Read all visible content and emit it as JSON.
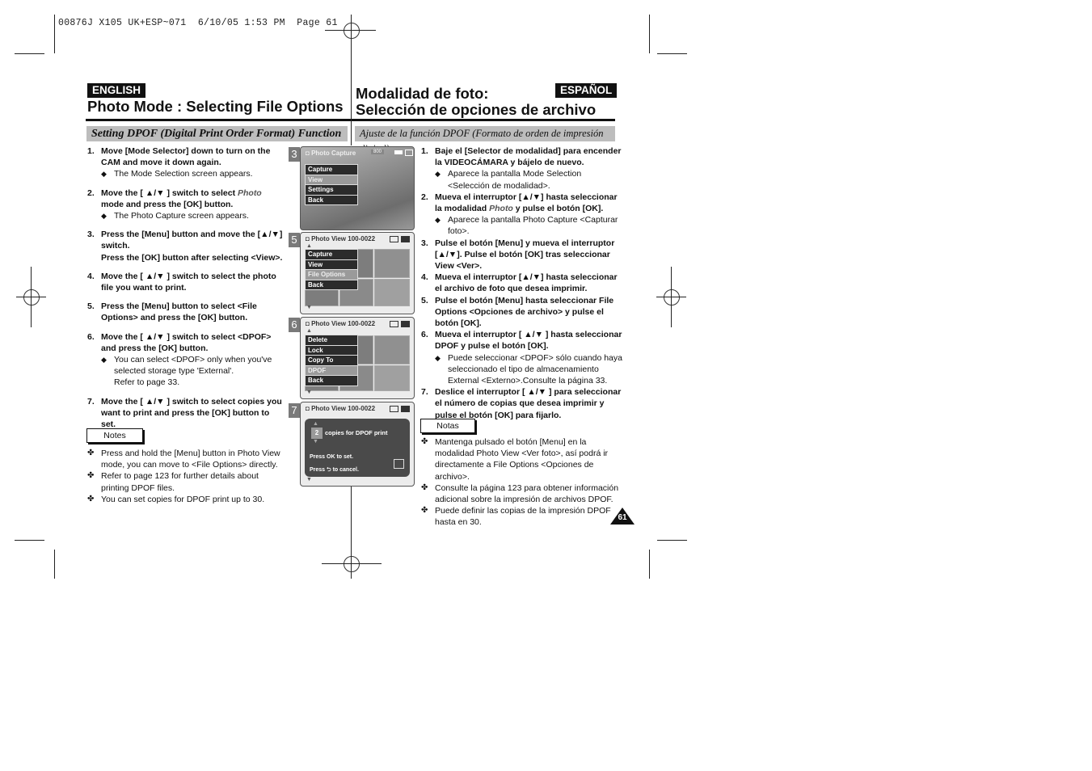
{
  "slug": "00876J X105 UK+ESP~071  6/10/05 1:53 PM  Page 61",
  "english": {
    "badge": "ENGLISH",
    "title": "Photo Mode : Selecting File Options",
    "subhead": "Setting DPOF (Digital Print Order Format) Function",
    "steps": [
      {
        "num": "1.",
        "text": "Move [Mode Selector] down to turn on the CAM and move it down again.",
        "subs": [
          "The Mode Selection screen appears."
        ]
      },
      {
        "num": "2.",
        "pre": "Move the [ ▲/▼ ] switch to select ",
        "italic": "Photo",
        "post": " mode and press the [OK] button.",
        "subs": [
          "The Photo Capture screen appears."
        ]
      },
      {
        "num": "3.",
        "text": "Press the [Menu] button and move the [▲/▼] switch.",
        "text2": "Press the [OK] button after selecting <View>.",
        "subs": []
      },
      {
        "num": "4.",
        "text": "Move the [ ▲/▼ ] switch to select the photo file you want to print.",
        "subs": []
      },
      {
        "num": "5.",
        "text": "Press the [Menu] button to select <File Options> and press the [OK] button.",
        "subs": []
      },
      {
        "num": "6.",
        "text": "Move the [ ▲/▼ ] switch to select <DPOF> and press the [OK] button.",
        "subs": [
          "You can select <DPOF> only when you've selected storage type 'External'.",
          "Refer to page 33."
        ]
      },
      {
        "num": "7.",
        "text": "Move the [ ▲/▼ ] switch to select copies you want to print and press the [OK] button to set.",
        "subs": []
      }
    ],
    "notes_label": "Notes",
    "notes": [
      "Press and hold the [Menu] button in Photo View mode, you can move to <File Options> directly.",
      "Refer to page 123 for further details about printing DPOF files.",
      "You can set copies for DPOF print up to 30."
    ]
  },
  "spanish": {
    "badge": "ESPAÑOL",
    "title_line1": "Modalidad de foto:",
    "title_line2": "Selección de opciones de archivo",
    "subhead": "Ajuste de la función DPOF (Formato de orden de impresión digital)",
    "steps": [
      {
        "num": "1.",
        "text": "Baje el [Selector de modalidad] para encender la VIDEOCÁMARA y bájelo de nuevo.",
        "subs": [
          "Aparece la pantalla Mode Selection <Selección de modalidad>."
        ]
      },
      {
        "num": "2.",
        "pre": "Mueva el interruptor [▲/▼] hasta seleccionar la modalidad ",
        "italic": "Photo",
        "post": " y pulse el botón [OK].",
        "subs": [
          "Aparece la pantalla Photo Capture <Capturar foto>."
        ]
      },
      {
        "num": "3.",
        "text": "Pulse el botón [Menu] y mueva el interruptor [▲/▼]. Pulse el botón [OK] tras seleccionar View <Ver>.",
        "subs": []
      },
      {
        "num": "4.",
        "text": "Mueva el interruptor [▲/▼] hasta seleccionar el archivo de foto que desea imprimir.",
        "subs": []
      },
      {
        "num": "5.",
        "text": "Pulse el botón [Menu] hasta seleccionar File Options <Opciones de archivo> y pulse el botón [OK].",
        "subs": []
      },
      {
        "num": "6.",
        "text": "Mueva el interruptor [ ▲/▼ ] hasta seleccionar DPOF y pulse el botón [OK].",
        "subs": [
          "Puede seleccionar <DPOF> sólo cuando haya seleccionado el tipo de almacenamiento External <Externo>.Consulte la página 33."
        ]
      },
      {
        "num": "7.",
        "text": "Deslice el interruptor [ ▲/▼ ] para seleccionar el número de copias que desea imprimir y pulse el botón [OK] para fijarlo.",
        "subs": []
      }
    ],
    "notes_label": "Notas",
    "notes": [
      "Mantenga pulsado el botón [Menu] en la modalidad Photo View <Ver foto>, así podrá ir directamente a File Options <Opciones de archivo>.",
      "Consulte la página 123 para obtener información adicional sobre la impresión de archivos DPOF.",
      "Puede definir las copias de la impresión DPOF hasta en 30."
    ]
  },
  "screens": [
    {
      "step": "3",
      "header": "Photo Capture",
      "counter": "800",
      "menu": [
        "Capture",
        "View",
        "Settings",
        "Back"
      ],
      "selected": 1
    },
    {
      "step": "5",
      "header": "Photo View  100-0022",
      "menu": [
        "Capture",
        "View",
        "File Options",
        "Back"
      ],
      "selected": 2
    },
    {
      "step": "6",
      "header": "Photo View  100-0022",
      "menu": [
        "Delete",
        "Lock",
        "Copy To",
        "DPOF",
        "Back"
      ],
      "selected": 3
    },
    {
      "step": "7",
      "header": "Photo View  100-0022",
      "copies": "2",
      "copies_label": "copies for DPOF print",
      "ok_text": "Press OK to set.",
      "cancel_pre": "Press",
      "cancel_post": "to cancel."
    }
  ],
  "page_number": "61",
  "bullet_glyph": "◆",
  "note_glyph": "✤"
}
